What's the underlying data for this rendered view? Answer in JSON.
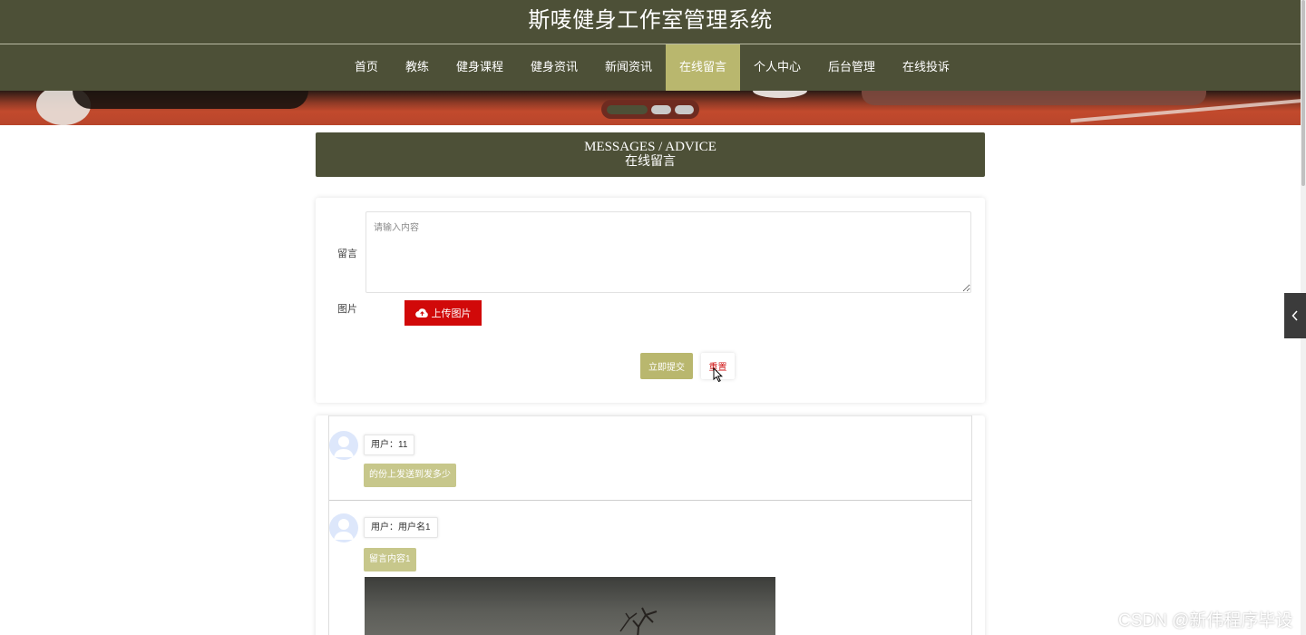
{
  "header": {
    "site_title": "斯唛健身工作室管理系统"
  },
  "nav": {
    "items": [
      "首页",
      "教练",
      "健身课程",
      "健身资讯",
      "新闻资讯",
      "在线留言",
      "个人中心",
      "后台管理",
      "在线投诉"
    ],
    "active_index": 5
  },
  "banner": {
    "slide_count": 3,
    "active_slide": 1
  },
  "section": {
    "title_en": "MESSAGES / ADVICE",
    "title_zh": "在线留言"
  },
  "form": {
    "message_label": "留言",
    "message_placeholder": "请输入内容",
    "image_label": "图片",
    "upload_label": "上传图片",
    "submit_label": "立即提交",
    "reset_label": "重置"
  },
  "messages": [
    {
      "user": "用户：11",
      "content": "的份上发送到发多少",
      "has_image": false
    },
    {
      "user": "用户：用户名1",
      "content": "留言内容1",
      "has_image": true
    }
  ],
  "watermark": "CSDN @新伟程序毕设",
  "colors": {
    "primary": "#4d5037",
    "accent": "#b9b76e",
    "upload": "#d10909",
    "bubble": "#c7c78b"
  },
  "icons": {
    "upload": "cloud-upload-icon",
    "avatar": "user-avatar-icon",
    "side_toggle": "chevron-left-icon"
  }
}
